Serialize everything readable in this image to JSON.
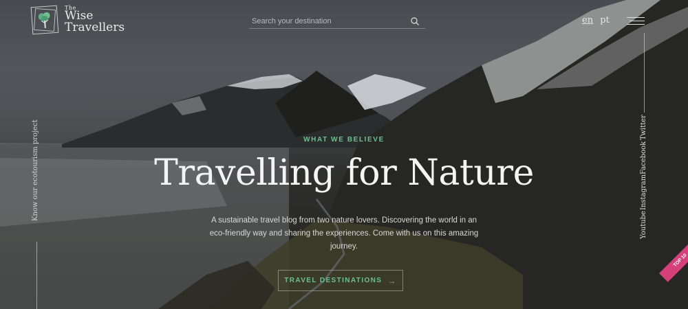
{
  "brand": {
    "the": "The",
    "wise": "Wise",
    "travellers": "Travellers"
  },
  "search": {
    "placeholder": "Search your destination",
    "icon": "search-icon"
  },
  "languages": [
    {
      "code": "en",
      "active": true
    },
    {
      "code": "pt",
      "active": false
    }
  ],
  "menu": {
    "icon": "hamburger-menu-icon"
  },
  "side_tagline": "Know our ecotourism project",
  "social": [
    "Twitter",
    "Facebook",
    "Instagram",
    "Youtube"
  ],
  "hero": {
    "eyebrow": "WHAT WE BELIEVE",
    "title": "Travelling for Nature",
    "description": "A sustainable travel blog from two nature lovers. Discovering the world in an eco-friendly way and sharing the experiences. Come with us on this amazing journey.",
    "cta_label": "TRAVEL DESTINATIONS",
    "cta_icon": "arrow-right-icon"
  },
  "badge": "TOP 10",
  "colors": {
    "accent": "#6fbf8f",
    "badge": "#d6407a"
  }
}
